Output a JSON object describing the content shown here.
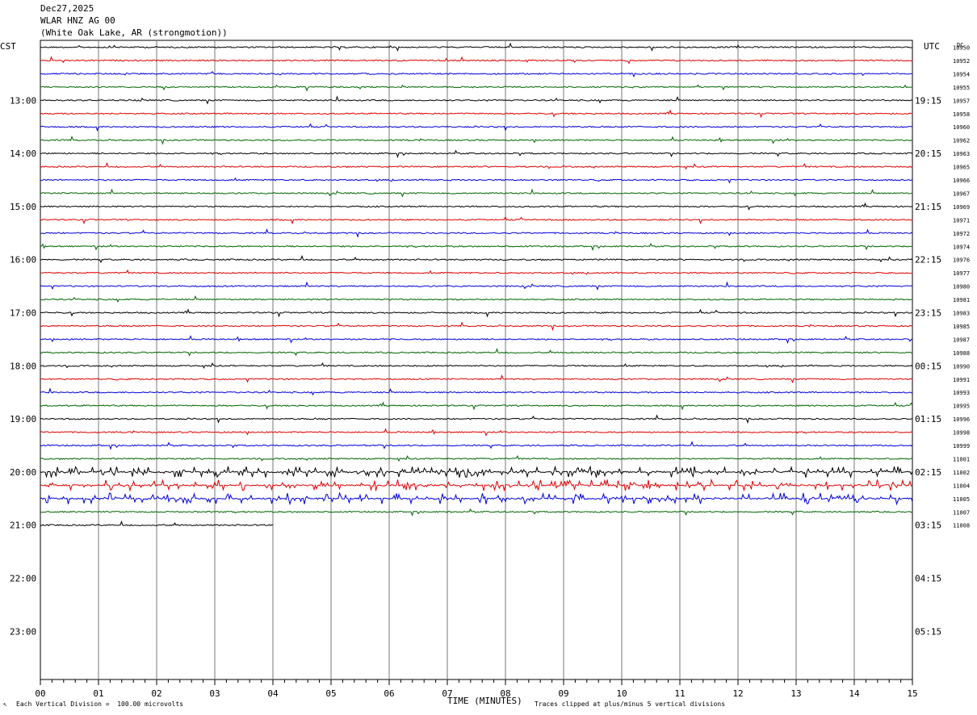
{
  "header": {
    "date": "Dec27,2025",
    "station": "WLAR HNZ AG 00",
    "location": "(White Oak Lake, AR (strongmotion))"
  },
  "axes": {
    "left_zone": "CST",
    "right_zone": "UTC",
    "dc_label": "DC",
    "x_title": "TIME (MINUTES)"
  },
  "footer": {
    "scale_note": "Each Vertical Division =  100.00 microvolts",
    "clip_note": "Traces clipped at plus/minus 5 vertical divisions"
  },
  "chart_data": {
    "type": "line",
    "title": "WLAR HNZ AG 00",
    "xlabel": "TIME (MINUTES)",
    "xlim": [
      0,
      15
    ],
    "x_ticks": [
      "00",
      "01",
      "02",
      "03",
      "04",
      "05",
      "06",
      "07",
      "08",
      "09",
      "10",
      "11",
      "12",
      "13",
      "14",
      "15"
    ],
    "rows_per_hour": 4,
    "row_minutes": 15,
    "colors": [
      "#000000",
      "#e00000",
      "#0000dd",
      "#006600"
    ],
    "left_hour_labels": [
      {
        "row": 4,
        "text": "13:00"
      },
      {
        "row": 8,
        "text": "14:00"
      },
      {
        "row": 12,
        "text": "15:00"
      },
      {
        "row": 16,
        "text": "16:00"
      },
      {
        "row": 20,
        "text": "17:00"
      },
      {
        "row": 24,
        "text": "18:00"
      },
      {
        "row": 28,
        "text": "19:00"
      },
      {
        "row": 32,
        "text": "20:00"
      },
      {
        "row": 36,
        "text": "21:00"
      },
      {
        "row": 40,
        "text": "22:00"
      },
      {
        "row": 44,
        "text": "23:00"
      }
    ],
    "right_hour_labels": [
      {
        "row": 4,
        "text": "19:15"
      },
      {
        "row": 8,
        "text": "20:15"
      },
      {
        "row": 12,
        "text": "21:15"
      },
      {
        "row": 16,
        "text": "22:15"
      },
      {
        "row": 20,
        "text": "23:15"
      },
      {
        "row": 24,
        "text": "00:15"
      },
      {
        "row": 28,
        "text": "01:15"
      },
      {
        "row": 32,
        "text": "02:15"
      },
      {
        "row": 36,
        "text": "03:15"
      },
      {
        "row": 40,
        "text": "04:15"
      },
      {
        "row": 44,
        "text": "05:15"
      }
    ],
    "dc_values": [
      "10950",
      "10952",
      "10954",
      "10955",
      "10957",
      "10958",
      "10960",
      "10962",
      "10963",
      "10965",
      "10966",
      "10967",
      "10969",
      "10971",
      "10972",
      "10974",
      "10976",
      "10977",
      "10980",
      "10981",
      "10983",
      "10985",
      "10987",
      "10988",
      "10990",
      "10991",
      "10993",
      "10995",
      "10996",
      "10998",
      "10999",
      "11001",
      "11002",
      "11004",
      "11005",
      "11007",
      "11008"
    ],
    "last_row_end_minute": 4,
    "noisy_rows": [
      32,
      33,
      34
    ]
  }
}
